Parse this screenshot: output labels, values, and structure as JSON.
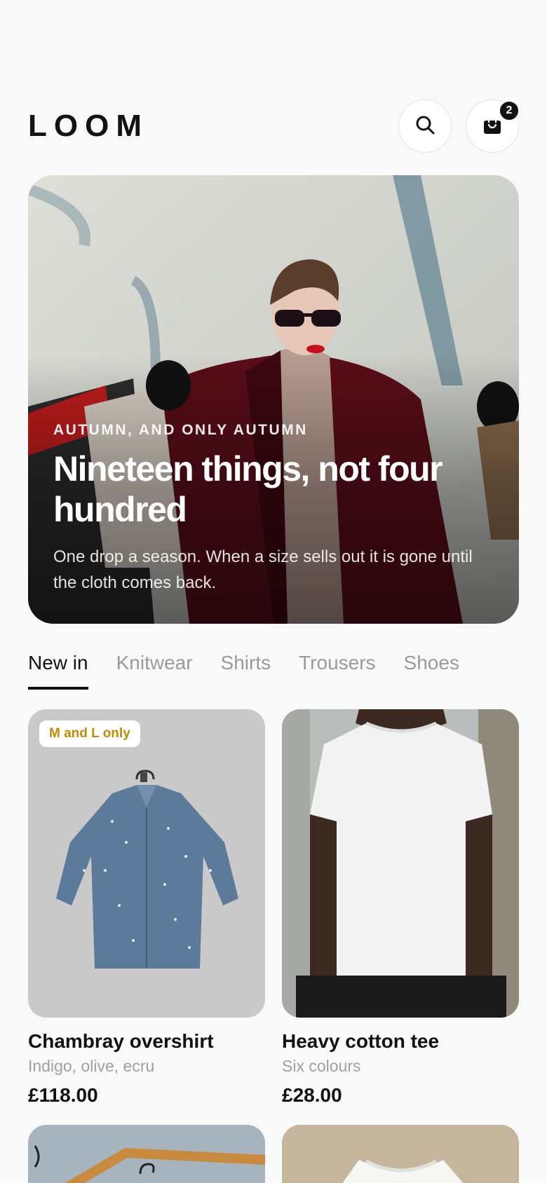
{
  "header": {
    "logo": "LOOM",
    "search_icon": "search-icon",
    "bag_icon": "shopping-bag-icon",
    "cart_count": "2"
  },
  "hero": {
    "eyebrow": "AUTUMN, AND ONLY AUTUMN",
    "title": "Nineteen things, not four hundred",
    "subtitle": "One drop a season. When a size sells out it is gone until the cloth comes back."
  },
  "tabs": [
    {
      "label": "New in",
      "active": true
    },
    {
      "label": "Knitwear",
      "active": false
    },
    {
      "label": "Shirts",
      "active": false
    },
    {
      "label": "Trousers",
      "active": false
    },
    {
      "label": "Shoes",
      "active": false
    }
  ],
  "products": [
    {
      "name": "Chambray overshirt",
      "colours": "Indigo, olive, ecru",
      "price": "£118.00",
      "badge": "M and L only"
    },
    {
      "name": "Heavy cotton tee",
      "colours": "Six colours",
      "price": "£28.00"
    }
  ],
  "colors": {
    "ink": "#121212",
    "muted": "#9a9a9a",
    "badge_text": "#c08b0a",
    "background": "#f9f9f9"
  }
}
